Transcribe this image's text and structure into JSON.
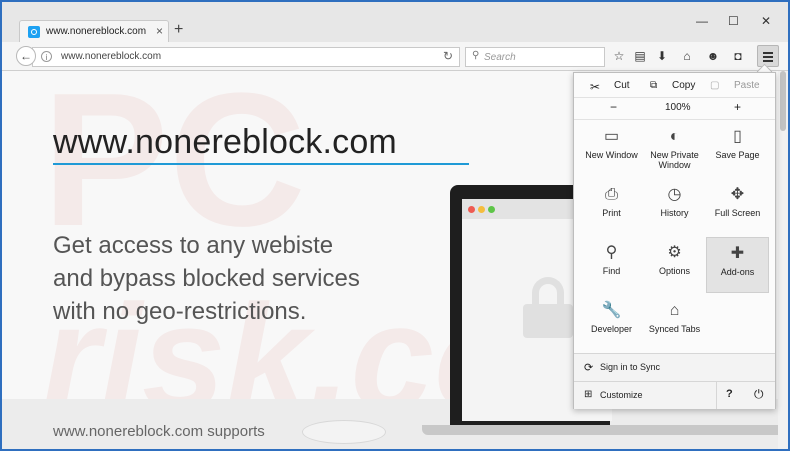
{
  "browser": {
    "tab": {
      "title": "www.nonereblock.com",
      "close": "×"
    },
    "new_tab": "+",
    "window_controls": {
      "minimize": "—",
      "maximize": "☐",
      "close": "✕"
    },
    "nav": {
      "back": "←",
      "url": "www.nonereblock.com",
      "info": "i",
      "reload": "↻",
      "search_placeholder": "Search"
    },
    "toolbar_icons": [
      "star-icon",
      "reading-list-icon",
      "download-icon",
      "home-icon",
      "chat-icon",
      "pocket-icon",
      "menu-icon"
    ]
  },
  "page": {
    "heading": "www.nonereblock.com",
    "tagline": [
      "Get access to any webiste",
      "and bypass blocked services",
      "with no geo-restrictions."
    ],
    "supports": "www.nonereblock.com supports",
    "watermark_top": "PC",
    "watermark_bottom": "risk.com",
    "accent": "#1f9ad6"
  },
  "menu": {
    "edit": {
      "cut": "Cut",
      "copy": "Copy",
      "paste": "Paste"
    },
    "zoom": {
      "out": "−",
      "level": "100%",
      "in": "+"
    },
    "items": [
      {
        "label": "New Window",
        "icon": "window-icon",
        "glyph": "▭"
      },
      {
        "label": "New Private Window",
        "icon": "mask-icon",
        "glyph": "◐"
      },
      {
        "label": "Save Page",
        "icon": "page-icon",
        "glyph": "▯"
      },
      {
        "label": "Print",
        "icon": "printer-icon",
        "glyph": "⎙"
      },
      {
        "label": "History",
        "icon": "clock-icon",
        "glyph": "◷"
      },
      {
        "label": "Full Screen",
        "icon": "fullscreen-icon",
        "glyph": "✥"
      },
      {
        "label": "Find",
        "icon": "magnifier-icon",
        "glyph": "⚲"
      },
      {
        "label": "Options",
        "icon": "gear-icon",
        "glyph": "⚙"
      },
      {
        "label": "Add-ons",
        "icon": "puzzle-icon",
        "glyph": "✚"
      },
      {
        "label": "Developer",
        "icon": "wrench-icon",
        "glyph": "🔧"
      },
      {
        "label": "Synced Tabs",
        "icon": "synced-tabs-icon",
        "glyph": "⌂"
      }
    ],
    "sign_in": "Sign in to Sync",
    "customize": "Customize",
    "help": "?",
    "quit": "⏻"
  }
}
